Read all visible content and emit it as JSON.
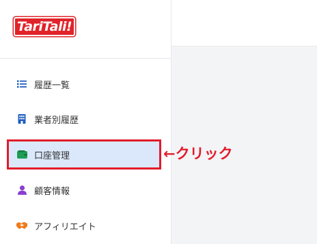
{
  "brand": {
    "logo_text": "TariTali!"
  },
  "sidebar": {
    "items": [
      {
        "label": "履歴一覧",
        "icon": "list-icon"
      },
      {
        "label": "業者別履歴",
        "icon": "building-icon"
      },
      {
        "label": "口座管理",
        "icon": "wallet-icon",
        "active": true
      },
      {
        "label": "顧客情報",
        "icon": "person-icon"
      },
      {
        "label": "アフィリエイト",
        "icon": "handshake-icon"
      }
    ]
  },
  "annotation": {
    "text": "←クリック"
  },
  "colors": {
    "accent_red": "#e21b2a",
    "active_bg": "#dbe8fb",
    "icon_blue": "#1f5fbf",
    "icon_green": "#1f9d55",
    "icon_purple": "#8b3fd1",
    "icon_orange": "#f07a1a"
  }
}
